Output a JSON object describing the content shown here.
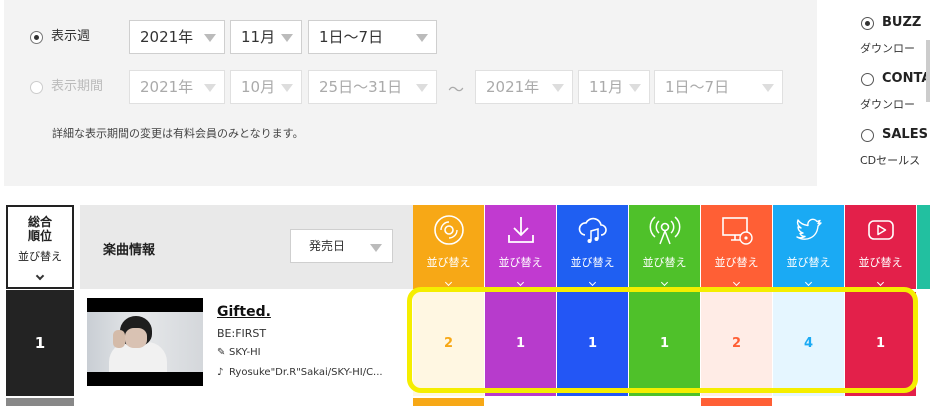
{
  "filter": {
    "week_label": "表示週",
    "week_year": "2021年",
    "week_month": "11月",
    "week_range": "1日〜7日",
    "period_label": "表示期間",
    "period_from_year": "2021年",
    "period_from_month": "10月",
    "period_from_range": "25日〜31日",
    "period_sep": "〜",
    "period_to_year": "2021年",
    "period_to_month": "11月",
    "period_to_range": "1日〜7日",
    "note": "詳細な表示期間の変更は有料会員のみとなります。"
  },
  "chart_type": {
    "options": [
      {
        "label": "BUZZ",
        "sub": "ダウンロー",
        "selected": true
      },
      {
        "label": "CONTA",
        "sub": "ダウンロー",
        "selected": false
      },
      {
        "label": "SALES",
        "sub": "CDセールス",
        "selected": false
      }
    ]
  },
  "table": {
    "rank_header": "総合\n順位",
    "rank_header_line1": "総合",
    "rank_header_line2": "順位",
    "sort_label": "並び替え",
    "info_header": "楽曲情報",
    "info_sort": "発売日",
    "metric_columns": [
      {
        "icon": "cd-icon",
        "color": "#f7a816",
        "label": "並び替え"
      },
      {
        "icon": "download-icon",
        "color": "#c13ad0",
        "label": "並び替え"
      },
      {
        "icon": "stream-cloud-icon",
        "color": "#1f5ff2",
        "label": "並び替え"
      },
      {
        "icon": "radio-icon",
        "color": "#4fc12a",
        "label": "並び替え"
      },
      {
        "icon": "pc-icon",
        "color": "#ff5f35",
        "label": "並び替え"
      },
      {
        "icon": "twitter-icon",
        "color": "#1aaaf4",
        "label": "並び替え"
      },
      {
        "icon": "youtube-icon",
        "color": "#e3204a",
        "label": "並び替え"
      }
    ],
    "rows": [
      {
        "rank": "1",
        "title": "Gifted.",
        "artist": "BE:FIRST",
        "lyricist": "SKY-HI",
        "composer": "Ryosuke\"Dr.R\"Sakai/SKY-HI/C...",
        "metrics": [
          {
            "value": "2",
            "bg": "#fff7e2",
            "fg": "#f7a816"
          },
          {
            "value": "1",
            "bg": "#b73bcc",
            "fg": "#ffffff"
          },
          {
            "value": "1",
            "bg": "#2356f5",
            "fg": "#ffffff"
          },
          {
            "value": "1",
            "bg": "#4fc12a",
            "fg": "#ffffff"
          },
          {
            "value": "2",
            "bg": "#ffece6",
            "fg": "#ff5f35"
          },
          {
            "value": "4",
            "bg": "#e5f6ff",
            "fg": "#1aaaf4"
          },
          {
            "value": "1",
            "bg": "#e3204a",
            "fg": "#ffffff"
          }
        ]
      }
    ]
  },
  "colors": {
    "highlight": "#f5ee00",
    "rank_bg": "#232323"
  }
}
